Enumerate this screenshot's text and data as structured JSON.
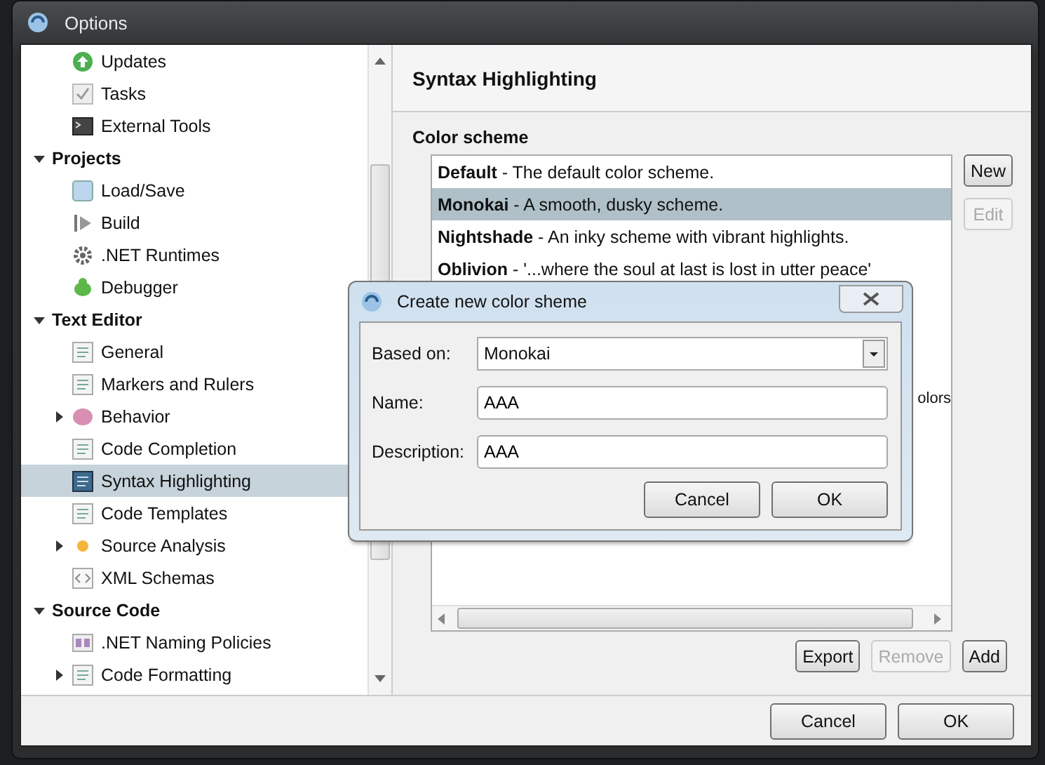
{
  "window": {
    "title": "Options"
  },
  "tree": {
    "leading_items": [
      {
        "label": "Updates",
        "selected": false
      },
      {
        "label": "Tasks",
        "selected": false
      },
      {
        "label": "External Tools",
        "selected": false
      }
    ],
    "categories": [
      {
        "label": "Projects",
        "expanded": true,
        "children": [
          {
            "label": "Load/Save",
            "selected": false
          },
          {
            "label": "Build",
            "selected": false
          },
          {
            "label": ".NET Runtimes",
            "selected": false
          },
          {
            "label": "Debugger",
            "selected": false
          }
        ]
      },
      {
        "label": "Text Editor",
        "expanded": true,
        "children": [
          {
            "label": "General",
            "selected": false
          },
          {
            "label": "Markers and Rulers",
            "selected": false
          },
          {
            "label": "Behavior",
            "selected": false,
            "expanded": false
          },
          {
            "label": "Code Completion",
            "selected": false
          },
          {
            "label": "Syntax Highlighting",
            "selected": true
          },
          {
            "label": "Code Templates",
            "selected": false
          },
          {
            "label": "Source Analysis",
            "selected": false,
            "expanded": false
          },
          {
            "label": "XML Schemas",
            "selected": false
          }
        ]
      },
      {
        "label": "Source Code",
        "expanded": true,
        "children": [
          {
            "label": ".NET Naming Policies",
            "selected": false
          },
          {
            "label": "Code Formatting",
            "selected": false,
            "expanded": false
          }
        ]
      }
    ]
  },
  "panel": {
    "title": "Syntax Highlighting",
    "section": "Color scheme",
    "schemes": [
      {
        "text": "**Default** - The default color scheme.",
        "selected": false
      },
      {
        "text": "**Monokai** - A smooth, dusky scheme.",
        "selected": true
      },
      {
        "text": "**Nightshade** - An inky scheme with vibrant highlights.",
        "selected": false
      },
      {
        "text": "**Oblivion** - '...where the soul at last is lost in utter peace'",
        "selected": false
      }
    ],
    "hidden_row_fragment": "olors",
    "side_buttons": [
      {
        "label": "New",
        "disabled": false
      },
      {
        "label": "Edit",
        "disabled": true
      }
    ],
    "bottom_buttons": [
      {
        "label": "Export",
        "disabled": false
      },
      {
        "label": "Remove",
        "disabled": true
      },
      {
        "label": "Add",
        "disabled": false
      }
    ]
  },
  "footer_buttons": [
    {
      "label": "Cancel"
    },
    {
      "label": "OK"
    }
  ],
  "dialog": {
    "title": "Create new color sheme",
    "fields": [
      {
        "label": "Based on:",
        "kind": "dropdown",
        "value": "Monokai"
      },
      {
        "label": "Name:",
        "kind": "text",
        "value": "AAA"
      },
      {
        "label": "Description:",
        "kind": "text",
        "value": "AAA"
      }
    ],
    "buttons": [
      {
        "label": "Cancel"
      },
      {
        "label": "OK"
      }
    ]
  }
}
